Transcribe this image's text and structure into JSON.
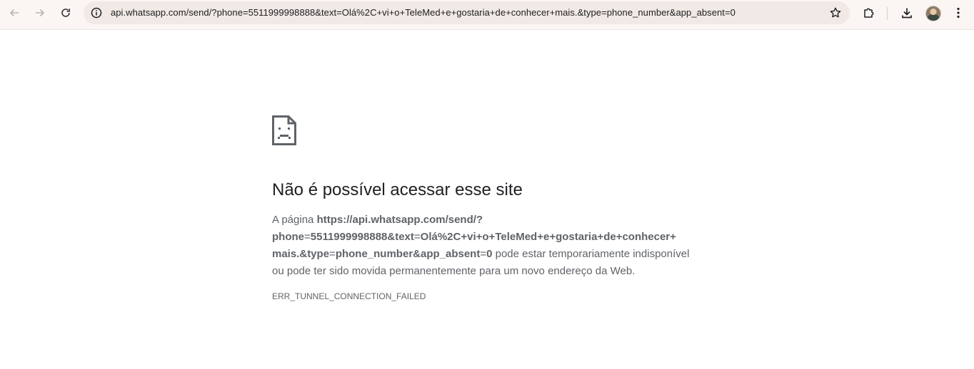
{
  "toolbar": {
    "back": "back-arrow",
    "forward": "forward-arrow",
    "reload": "reload",
    "url": "api.whatsapp.com/send/?phone=5511999998888&text=Olá%2C+vi+o+TeleMed+e+gostaria+de+conhecer+mais.&type=phone_number&app_absent=0",
    "site_info_icon": "info-circle",
    "bookmark_icon": "star-outline",
    "extensions_icon": "puzzle",
    "downloads_icon": "download",
    "menu_icon": "three-dots-vertical"
  },
  "error_page": {
    "icon": "sad-page-icon",
    "title": "Não é possível acessar esse site",
    "desc_prefix": "A página ",
    "url_line1": "https://api.whatsapp.com/send/?",
    "url_line2_parts": [
      "phone",
      "=",
      "5511999998888&text",
      "=",
      "Olá%2C+vi+o+TeleMed+e+gostaria+de+conhecer+"
    ],
    "url_line3_parts": [
      "mais.&type",
      "=",
      "phone_number&app_absent",
      "=",
      "0"
    ],
    "desc_suffix": " pode estar temporariamente indisponível ou pode ter sido movida permanentemente para um novo endereço da Web.",
    "error_code": "ERR_TUNNEL_CONNECTION_FAILED"
  },
  "colors": {
    "toolbar_bg": "#fbf6f3",
    "omnibox_bg": "#f1e9e5",
    "text_primary": "#202124",
    "text_secondary": "#5f6368"
  }
}
